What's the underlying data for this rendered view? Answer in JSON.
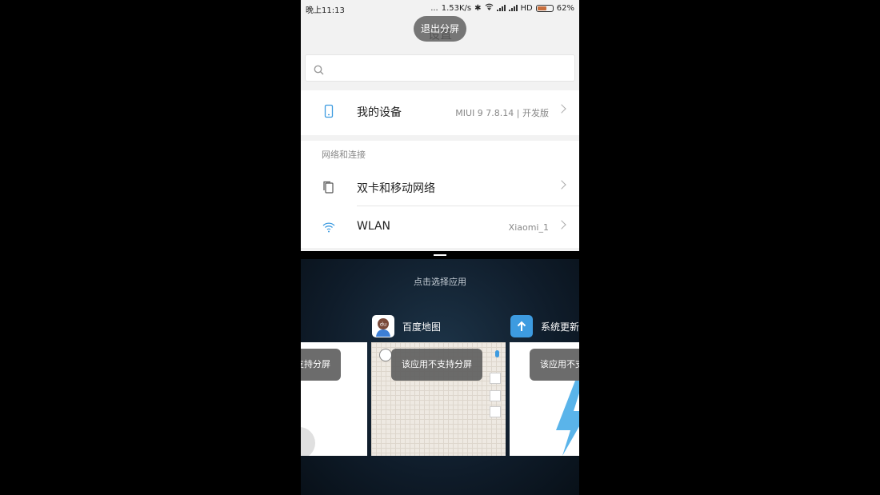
{
  "status_bar": {
    "time": "晚上11:13",
    "net_speed": "1.53K/s",
    "network_type": "HD",
    "battery": "62%",
    "battery_level": 0.62,
    "dots": "..."
  },
  "settings": {
    "title": "设置",
    "exit_split_label": "退出分屏",
    "search_placeholder": "",
    "my_device": {
      "label": "我的设备",
      "value": "MIUI 9 7.8.14 | 开发版"
    },
    "section_network": "网络和连接",
    "dual_sim": {
      "label": "双卡和移动网络",
      "value": ""
    },
    "wlan": {
      "label": "WLAN",
      "value": "Xiaomi_1"
    }
  },
  "app_picker": {
    "hint": "点击选择应用",
    "apps": [
      {
        "name": "",
        "toast": "支持分屏"
      },
      {
        "name": "百度地图",
        "toast": "该应用不支持分屏",
        "icon_text": "du"
      },
      {
        "name": "系统更新",
        "toast": "该应用不支"
      }
    ]
  },
  "colors": {
    "accent_blue": "#3d9be0",
    "toast_bg": "#5f5f5f",
    "picker_bg": "#13222f"
  }
}
